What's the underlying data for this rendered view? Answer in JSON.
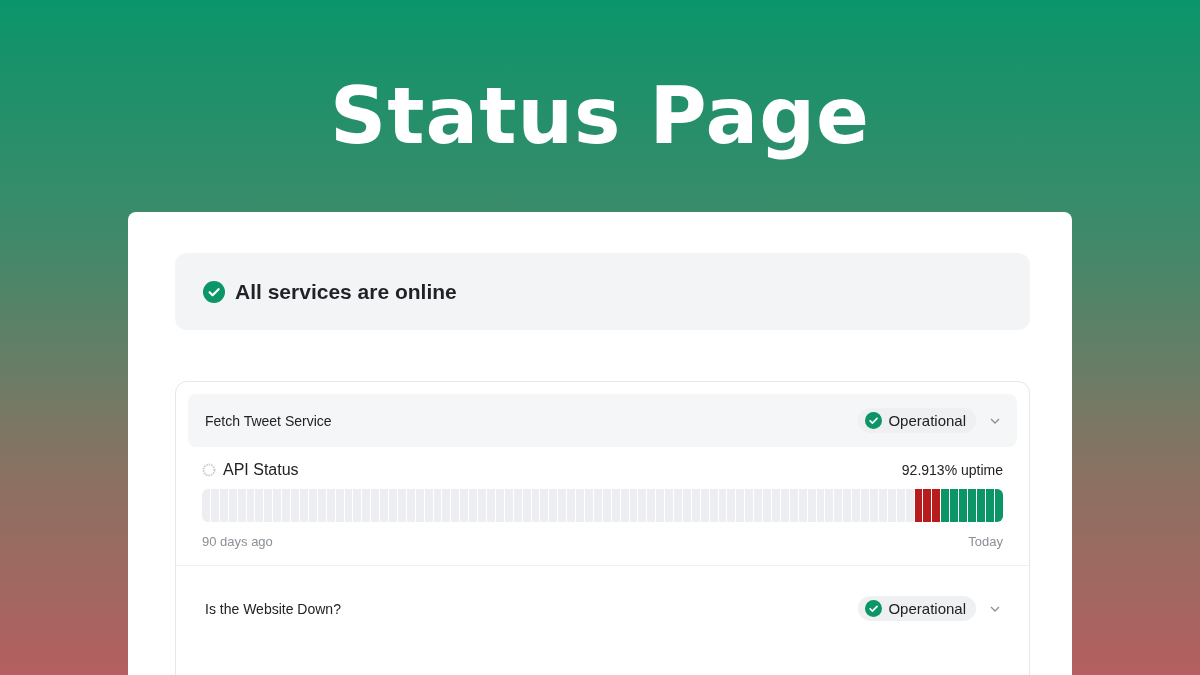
{
  "title": "Status Page",
  "banner": {
    "text": "All services are online",
    "kind": "ok"
  },
  "services": [
    {
      "name": "Fetch Tweet Service",
      "status": {
        "label": "Operational",
        "kind": "ok"
      },
      "monitors": [
        {
          "name": "API Status",
          "uptime": "92.913% uptime",
          "start_label": "90 days ago",
          "end_label": "Today",
          "days": [
            {
              "kind": "none"
            },
            {
              "kind": "none"
            },
            {
              "kind": "none"
            },
            {
              "kind": "none"
            },
            {
              "kind": "none"
            },
            {
              "kind": "none"
            },
            {
              "kind": "none"
            },
            {
              "kind": "none"
            },
            {
              "kind": "none"
            },
            {
              "kind": "none"
            },
            {
              "kind": "none"
            },
            {
              "kind": "none"
            },
            {
              "kind": "none"
            },
            {
              "kind": "none"
            },
            {
              "kind": "none"
            },
            {
              "kind": "none"
            },
            {
              "kind": "none"
            },
            {
              "kind": "none"
            },
            {
              "kind": "none"
            },
            {
              "kind": "none"
            },
            {
              "kind": "none"
            },
            {
              "kind": "none"
            },
            {
              "kind": "none"
            },
            {
              "kind": "none"
            },
            {
              "kind": "none"
            },
            {
              "kind": "none"
            },
            {
              "kind": "none"
            },
            {
              "kind": "none"
            },
            {
              "kind": "none"
            },
            {
              "kind": "none"
            },
            {
              "kind": "none"
            },
            {
              "kind": "none"
            },
            {
              "kind": "none"
            },
            {
              "kind": "none"
            },
            {
              "kind": "none"
            },
            {
              "kind": "none"
            },
            {
              "kind": "none"
            },
            {
              "kind": "none"
            },
            {
              "kind": "none"
            },
            {
              "kind": "none"
            },
            {
              "kind": "none"
            },
            {
              "kind": "none"
            },
            {
              "kind": "none"
            },
            {
              "kind": "none"
            },
            {
              "kind": "none"
            },
            {
              "kind": "none"
            },
            {
              "kind": "none"
            },
            {
              "kind": "none"
            },
            {
              "kind": "none"
            },
            {
              "kind": "none"
            },
            {
              "kind": "none"
            },
            {
              "kind": "none"
            },
            {
              "kind": "none"
            },
            {
              "kind": "none"
            },
            {
              "kind": "none"
            },
            {
              "kind": "none"
            },
            {
              "kind": "none"
            },
            {
              "kind": "none"
            },
            {
              "kind": "none"
            },
            {
              "kind": "none"
            },
            {
              "kind": "none"
            },
            {
              "kind": "none"
            },
            {
              "kind": "none"
            },
            {
              "kind": "none"
            },
            {
              "kind": "none"
            },
            {
              "kind": "none"
            },
            {
              "kind": "none"
            },
            {
              "kind": "none"
            },
            {
              "kind": "none"
            },
            {
              "kind": "none"
            },
            {
              "kind": "none"
            },
            {
              "kind": "none"
            },
            {
              "kind": "none"
            },
            {
              "kind": "none"
            },
            {
              "kind": "none"
            },
            {
              "kind": "none"
            },
            {
              "kind": "none"
            },
            {
              "kind": "none"
            },
            {
              "kind": "none"
            },
            {
              "kind": "none"
            },
            {
              "kind": "down"
            },
            {
              "kind": "down"
            },
            {
              "kind": "down"
            },
            {
              "kind": "up"
            },
            {
              "kind": "up"
            },
            {
              "kind": "up"
            },
            {
              "kind": "up"
            },
            {
              "kind": "up"
            },
            {
              "kind": "up"
            },
            {
              "kind": "up"
            }
          ]
        }
      ]
    },
    {
      "name": "Is the Website Down?",
      "status": {
        "label": "Operational",
        "kind": "ok"
      }
    }
  ]
}
